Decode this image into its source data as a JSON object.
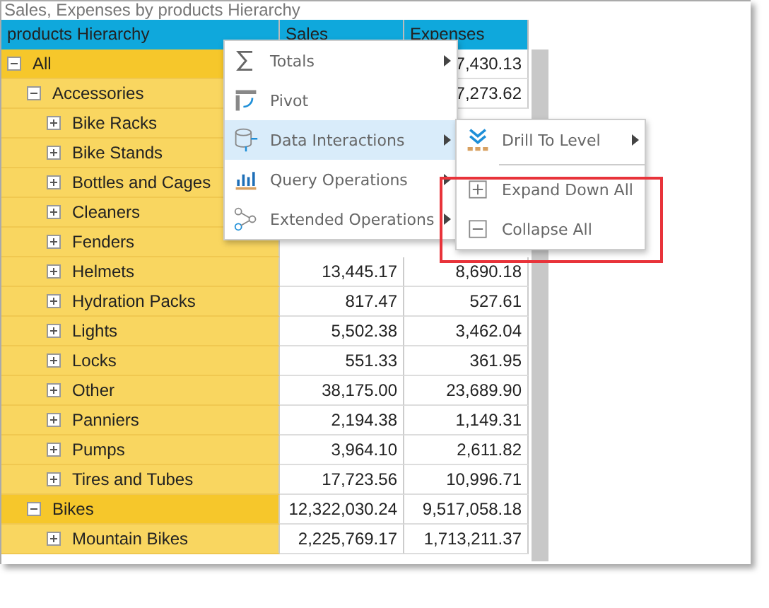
{
  "title": "Sales, Expenses by products Hierarchy",
  "table": {
    "columns": [
      "products Hierarchy",
      "Sales",
      "Expenses"
    ],
    "rows": [
      {
        "label": "All",
        "expanded": true,
        "highlighted": true,
        "expenses": "7,430.13",
        "children": [
          {
            "label": "Accessories",
            "expanded": true,
            "highlighted": false,
            "expenses": "7,273.62",
            "children": [
              {
                "label": "Bike Racks",
                "expanded": false,
                "highlighted": false
              },
              {
                "label": "Bike Stands",
                "expanded": false,
                "highlighted": false
              },
              {
                "label": "Bottles and Cages",
                "expanded": false,
                "highlighted": false
              },
              {
                "label": "Cleaners",
                "expanded": false,
                "highlighted": false
              },
              {
                "label": "Fenders",
                "expanded": false,
                "highlighted": false
              },
              {
                "label": "Helmets",
                "expanded": false,
                "highlighted": false,
                "sales": "13,445.17",
                "expenses": "8,690.18"
              },
              {
                "label": "Hydration Packs",
                "expanded": false,
                "highlighted": false,
                "sales": "817.47",
                "expenses": "527.61"
              },
              {
                "label": "Lights",
                "expanded": false,
                "highlighted": false,
                "sales": "5,502.38",
                "expenses": "3,462.04"
              },
              {
                "label": "Locks",
                "expanded": false,
                "highlighted": false,
                "sales": "551.33",
                "expenses": "361.95"
              },
              {
                "label": "Other",
                "expanded": false,
                "highlighted": false,
                "sales": "38,175.00",
                "expenses": "23,689.90"
              },
              {
                "label": "Panniers",
                "expanded": false,
                "highlighted": false,
                "sales": "2,194.38",
                "expenses": "1,149.31"
              },
              {
                "label": "Pumps",
                "expanded": false,
                "highlighted": false,
                "sales": "3,964.10",
                "expenses": "2,611.82"
              },
              {
                "label": "Tires and Tubes",
                "expanded": false,
                "highlighted": false,
                "sales": "17,723.56",
                "expenses": "10,996.71"
              }
            ]
          },
          {
            "label": "Bikes",
            "expanded": true,
            "highlighted": true,
            "sales": "12,322,030.24",
            "expenses": "9,517,058.18",
            "children": [
              {
                "label": "Mountain Bikes",
                "expanded": false,
                "highlighted": false,
                "sales": "2,225,769.17",
                "expenses": "1,713,211.37"
              }
            ]
          }
        ]
      }
    ]
  },
  "context_menu": {
    "items": [
      {
        "kind": "totals",
        "label": "Totals",
        "submenu": true,
        "selected": false
      },
      {
        "kind": "pivot",
        "label": "Pivot",
        "submenu": false,
        "selected": false
      },
      {
        "kind": "data",
        "label": "Data Interactions",
        "submenu": true,
        "selected": true
      },
      {
        "kind": "query",
        "label": "Query Operations",
        "submenu": true,
        "selected": false
      },
      {
        "kind": "extended",
        "label": "Extended Operations",
        "submenu": true,
        "selected": false
      }
    ]
  },
  "submenu": {
    "items": [
      {
        "kind": "drill",
        "label": "Drill To Level",
        "submenu": true
      },
      {
        "kind": "expand",
        "label": "Expand Down All",
        "submenu": false
      },
      {
        "kind": "collapse",
        "label": "Collapse All",
        "submenu": false
      }
    ]
  }
}
